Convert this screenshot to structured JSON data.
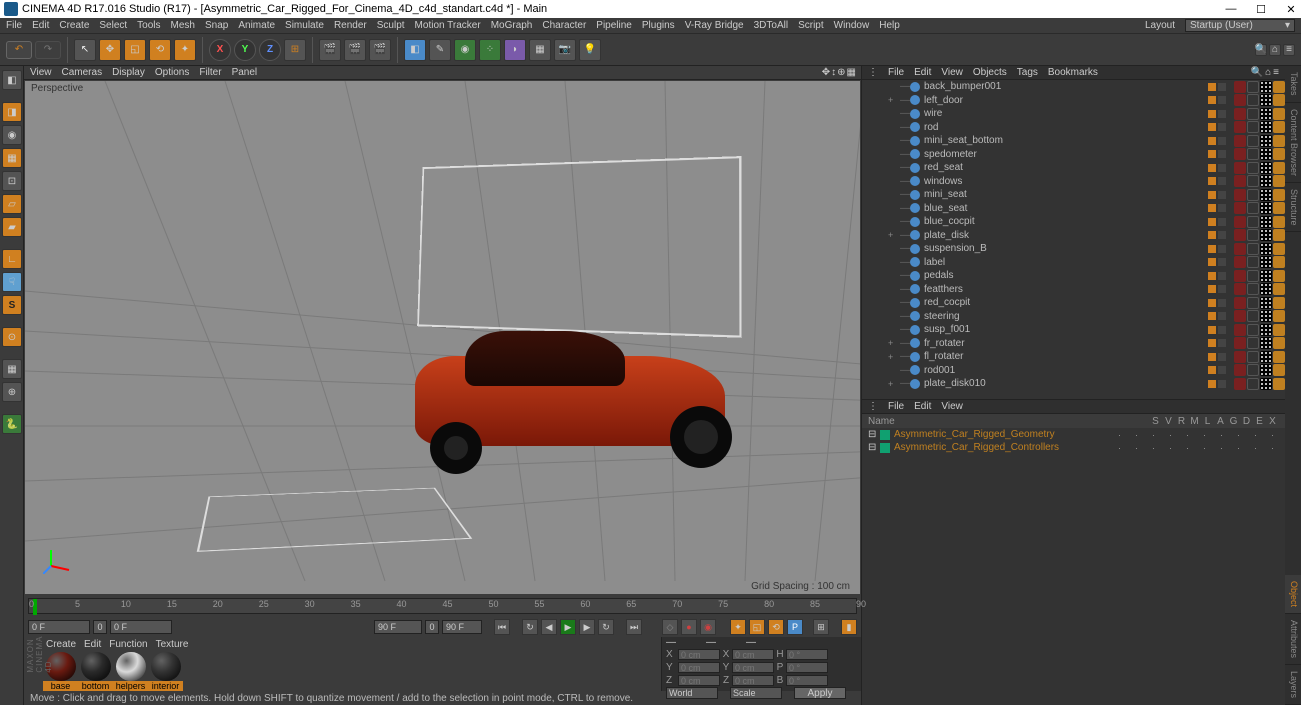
{
  "title": "CINEMA 4D R17.016 Studio (R17) - [Asymmetric_Car_Rigged_For_Cinema_4D_c4d_standart.c4d *] - Main",
  "menubar": [
    "File",
    "Edit",
    "Create",
    "Select",
    "Tools",
    "Mesh",
    "Snap",
    "Animate",
    "Simulate",
    "Render",
    "Sculpt",
    "Motion Tracker",
    "MoGraph",
    "Character",
    "Pipeline",
    "Plugins",
    "V-Ray Bridge",
    "3DToAll",
    "Script",
    "Window",
    "Help"
  ],
  "layout_label": "Layout",
  "layout_value": "Startup (User)",
  "viewport_menu": [
    "View",
    "Cameras",
    "Display",
    "Options",
    "Filter",
    "Panel"
  ],
  "viewport_label": "Perspective",
  "grid_spacing": "Grid Spacing : 100 cm",
  "timeline_ticks": [
    "0",
    "5",
    "10",
    "15",
    "20",
    "25",
    "30",
    "35",
    "40",
    "45",
    "50",
    "55",
    "60",
    "65",
    "70",
    "75",
    "80",
    "85",
    "90"
  ],
  "playbar": {
    "start": "0 F",
    "start_pad": "0",
    "cur": "0 F",
    "end": "90 F",
    "end_pad": "0",
    "total": "90 F"
  },
  "materials_tabs": [
    "Create",
    "Edit",
    "Function",
    "Texture"
  ],
  "materials": [
    {
      "name": "base",
      "color": "#6a1a10"
    },
    {
      "name": "bottom",
      "color": "#2a2a2a"
    },
    {
      "name": "helpers",
      "color": "#dadada"
    },
    {
      "name": "interior",
      "color": "#333"
    }
  ],
  "object_menu": [
    "File",
    "Edit",
    "View",
    "Objects",
    "Tags",
    "Bookmarks"
  ],
  "objects": [
    {
      "name": "back_bumper001",
      "exp": ""
    },
    {
      "name": "left_door",
      "exp": "+"
    },
    {
      "name": "wire",
      "exp": ""
    },
    {
      "name": "rod",
      "exp": ""
    },
    {
      "name": "mini_seat_bottom",
      "exp": ""
    },
    {
      "name": "spedometer",
      "exp": ""
    },
    {
      "name": "red_seat",
      "exp": ""
    },
    {
      "name": "windows",
      "exp": ""
    },
    {
      "name": "mini_seat",
      "exp": ""
    },
    {
      "name": "blue_seat",
      "exp": ""
    },
    {
      "name": "blue_cocpit",
      "exp": ""
    },
    {
      "name": "plate_disk",
      "exp": "+"
    },
    {
      "name": "suspension_B",
      "exp": ""
    },
    {
      "name": "label",
      "exp": ""
    },
    {
      "name": "pedals",
      "exp": ""
    },
    {
      "name": "featthers",
      "exp": ""
    },
    {
      "name": "red_cocpit",
      "exp": ""
    },
    {
      "name": "steering",
      "exp": ""
    },
    {
      "name": "susp_f001",
      "exp": ""
    },
    {
      "name": "fr_rotater",
      "exp": "+"
    },
    {
      "name": "fl_rotater",
      "exp": "+"
    },
    {
      "name": "rod001",
      "exp": ""
    },
    {
      "name": "plate_disk010",
      "exp": "+"
    }
  ],
  "layer_menu": [
    "File",
    "Edit",
    "View"
  ],
  "layer_headers": [
    "Name",
    "S",
    "V",
    "R",
    "M",
    "L",
    "A",
    "G",
    "D",
    "E",
    "X"
  ],
  "layers": [
    {
      "name": "Asymmetric_Car_Rigged_Geometry",
      "color": "#10a070"
    },
    {
      "name": "Asymmetric_Car_Rigged_Controllers",
      "color": "#10a070"
    }
  ],
  "coord": {
    "headers": [
      "—",
      "—",
      "—"
    ],
    "rows": [
      {
        "lbl": "X",
        "p": "0 cm",
        "s": "0 cm",
        "r": "0 °",
        "h": "H"
      },
      {
        "lbl": "Y",
        "p": "0 cm",
        "s": "0 cm",
        "r": "0 °",
        "h": "P"
      },
      {
        "lbl": "Z",
        "p": "0 cm",
        "s": "0 cm",
        "r": "0 °",
        "h": "B"
      }
    ],
    "world": "World",
    "scale": "Scale",
    "apply": "Apply"
  },
  "status": "Move : Click and drag to move elements. Hold down SHIFT to quantize movement / add to the selection in point mode, CTRL to remove.",
  "side_tabs_top": [
    "Takes",
    "Content Browser",
    "Structure"
  ],
  "side_tabs_bottom": [
    "Object",
    "Attributes",
    "Layers"
  ],
  "maxon": "MAXON CINEMA 4D",
  "axes": {
    "x": "X",
    "y": "Y",
    "z": "Z"
  }
}
